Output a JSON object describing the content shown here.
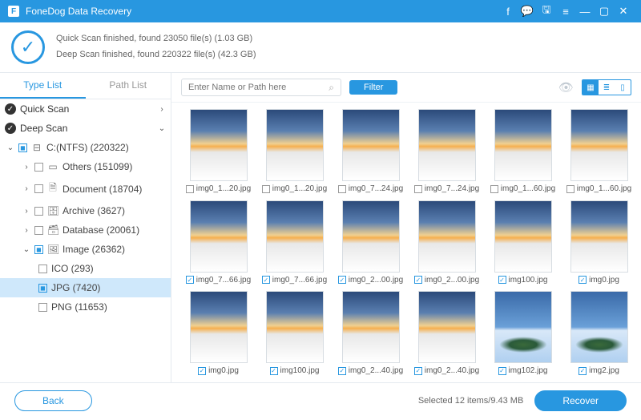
{
  "titlebar": {
    "app_name": "FoneDog Data Recovery"
  },
  "status": {
    "line1": "Quick Scan finished, found 23050 file(s) (1.03 GB)",
    "line2": "Deep Scan finished, found 220322 file(s) (42.3 GB)"
  },
  "sidebar": {
    "tab_type": "Type List",
    "tab_path": "Path List",
    "quick_scan": "Quick Scan",
    "deep_scan": "Deep Scan",
    "drive": "C:(NTFS) (220322)",
    "others": "Others (151099)",
    "document": "Document (18704)",
    "archive": "Archive (3627)",
    "database": "Database (20061)",
    "image": "Image (26362)",
    "ico": "ICO (293)",
    "jpg": "JPG (7420)",
    "png": "PNG (11653)"
  },
  "toolbar": {
    "search_placeholder": "Enter Name or Path here",
    "filter": "Filter"
  },
  "items": [
    {
      "name": "img0_1...20.jpg",
      "checked": false,
      "island": false
    },
    {
      "name": "img0_1...20.jpg",
      "checked": false,
      "island": false
    },
    {
      "name": "img0_7...24.jpg",
      "checked": false,
      "island": false
    },
    {
      "name": "img0_7...24.jpg",
      "checked": false,
      "island": false
    },
    {
      "name": "img0_1...60.jpg",
      "checked": false,
      "island": false
    },
    {
      "name": "img0_1...60.jpg",
      "checked": false,
      "island": false
    },
    {
      "name": "img0_7...66.jpg",
      "checked": true,
      "island": false
    },
    {
      "name": "img0_7...66.jpg",
      "checked": true,
      "island": false
    },
    {
      "name": "img0_2...00.jpg",
      "checked": true,
      "island": false
    },
    {
      "name": "img0_2...00.jpg",
      "checked": true,
      "island": false
    },
    {
      "name": "img100.jpg",
      "checked": true,
      "island": false
    },
    {
      "name": "img0.jpg",
      "checked": true,
      "island": false
    },
    {
      "name": "img0.jpg",
      "checked": true,
      "island": false
    },
    {
      "name": "img100.jpg",
      "checked": true,
      "island": false
    },
    {
      "name": "img0_2...40.jpg",
      "checked": true,
      "island": false
    },
    {
      "name": "img0_2...40.jpg",
      "checked": true,
      "island": false
    },
    {
      "name": "img102.jpg",
      "checked": true,
      "island": true
    },
    {
      "name": "img2.jpg",
      "checked": true,
      "island": true
    }
  ],
  "footer": {
    "back": "Back",
    "selection": "Selected 12 items/9.43 MB",
    "recover": "Recover"
  }
}
